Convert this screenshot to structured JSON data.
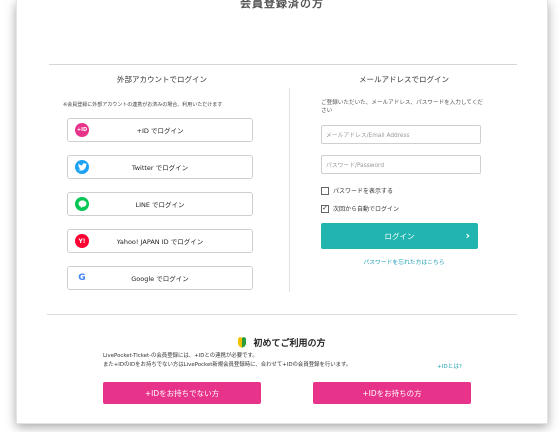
{
  "page": {
    "top_title": "会員登録済の方"
  },
  "external": {
    "heading": "外部アカウントでログイン",
    "note": "※会員登録に外部アカウントの連携がお済みの場合、利用いただけます",
    "buttons": [
      {
        "label": "+ID でログイン",
        "icon": "plus-id-icon",
        "icon_text": "+ID",
        "color": "#e8338a"
      },
      {
        "label": "Twitter でログイン",
        "icon": "twitter-icon",
        "icon_text": "",
        "color": "#1da1f2"
      },
      {
        "label": "LINE でログイン",
        "icon": "line-icon",
        "icon_text": "",
        "color": "#06c755"
      },
      {
        "label": "Yahoo! JAPAN ID でログイン",
        "icon": "yahoo-icon",
        "icon_text": "Y!",
        "color": "#ff0033"
      },
      {
        "label": "Google でログイン",
        "icon": "google-icon",
        "icon_text": "G",
        "color": "#ffffff"
      }
    ]
  },
  "email": {
    "heading": "メールアドレスでログイン",
    "note": "ご登録いただいた、メールアドレス、パスワードを入力してください",
    "email_placeholder": "メールアドレス/Email Address",
    "password_placeholder": "パスワード/Password",
    "show_password_label": "パスワードを表示する",
    "show_password_checked": false,
    "auto_login_label": "次回から自動でログイン",
    "auto_login_checked": true,
    "login_button": "ログイン",
    "forgot_link": "パスワードを忘れた方はこちら"
  },
  "first_time": {
    "heading": "初めてご利用の方",
    "line1": "LivePocket-Ticket-の会員登録には、+IDとの連携が必要です。",
    "line2": "また+IDのIDをお持ちでない方はLivePocket新規会員登録時に、合わせて+IDの会員登録を行います。",
    "what_link": "+IDとは?",
    "btn_no_id": "+IDをお持ちでない方",
    "btn_have_id": "+IDをお持ちの方"
  },
  "colors": {
    "teal": "#22b5b0",
    "pink": "#e8338a",
    "link": "#1b9fb4"
  }
}
